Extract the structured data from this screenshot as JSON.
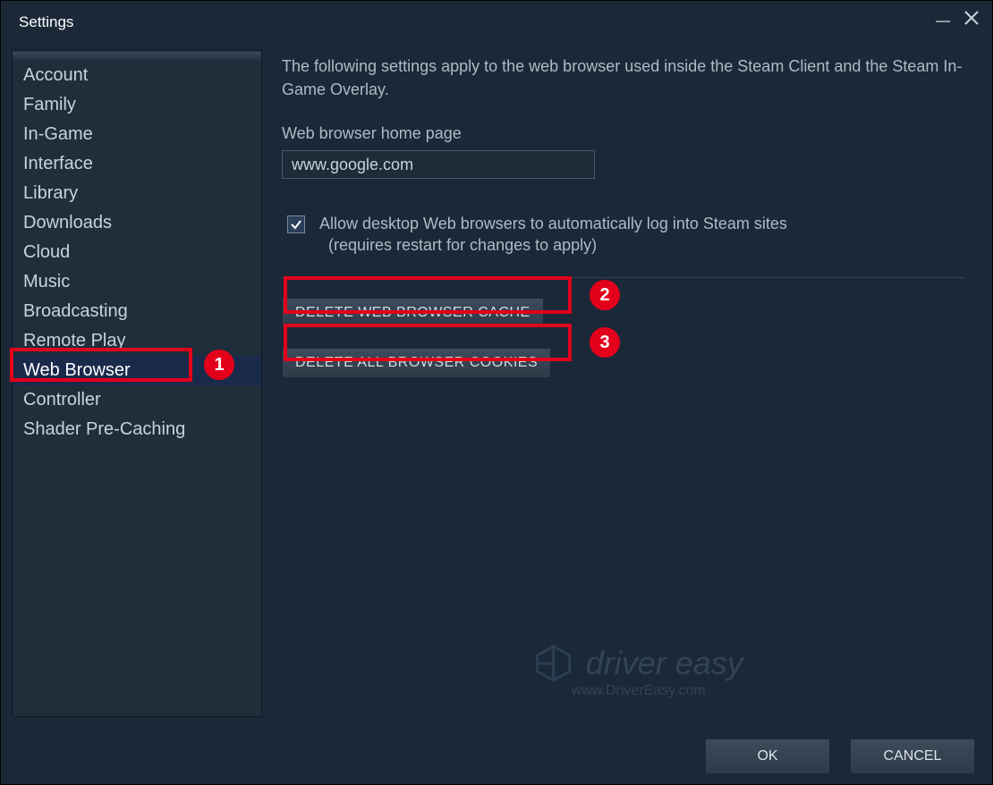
{
  "window": {
    "title": "Settings"
  },
  "sidebar": {
    "items": [
      {
        "label": "Account"
      },
      {
        "label": "Family"
      },
      {
        "label": "In-Game"
      },
      {
        "label": "Interface"
      },
      {
        "label": "Library"
      },
      {
        "label": "Downloads"
      },
      {
        "label": "Cloud"
      },
      {
        "label": "Music"
      },
      {
        "label": "Broadcasting"
      },
      {
        "label": "Remote Play"
      },
      {
        "label": "Web Browser"
      },
      {
        "label": "Controller"
      },
      {
        "label": "Shader Pre-Caching"
      }
    ],
    "active_index": 10
  },
  "content": {
    "description": "The following settings apply to the web browser used inside the Steam Client and the Steam In-Game Overlay.",
    "homepage_label": "Web browser home page",
    "homepage_value": "www.google.com",
    "autologin_checked": true,
    "autologin_line1": "Allow desktop Web browsers to automatically log into Steam sites",
    "autologin_line2": "(requires restart for changes to apply)",
    "delete_cache_label": "DELETE WEB BROWSER CACHE",
    "delete_cookies_label": "DELETE ALL BROWSER COOKIES"
  },
  "footer": {
    "ok": "OK",
    "cancel": "CANCEL"
  },
  "watermark": {
    "brand": "driver easy",
    "url": "www.DriverEasy.com"
  },
  "annotations": {
    "badge1": "1",
    "badge2": "2",
    "badge3": "3"
  }
}
